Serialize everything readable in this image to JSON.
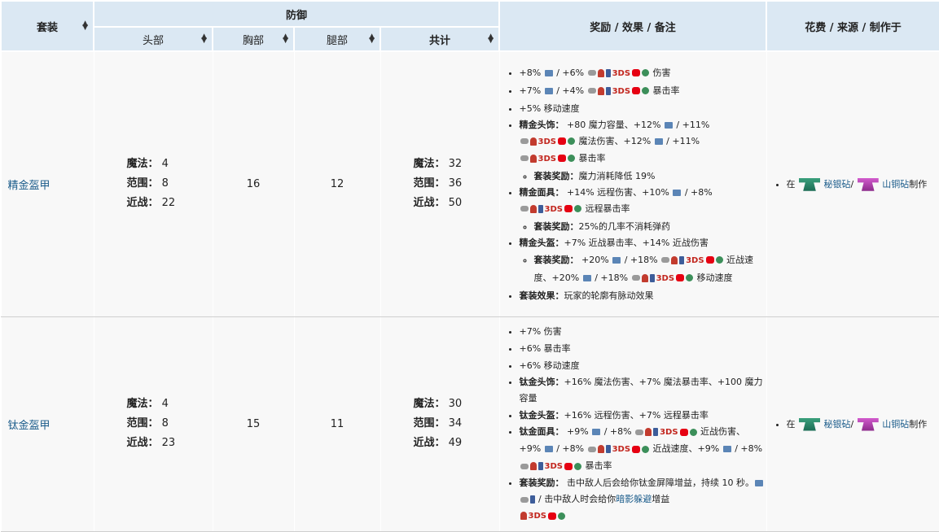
{
  "header": {
    "set": "套装",
    "defense": "防御",
    "head": "头部",
    "chest": "胸部",
    "legs": "腿部",
    "total": "共计",
    "bonus": "奖励 / 效果 / 备注",
    "cost": "花费 / 来源 / 制作于"
  },
  "row1": {
    "name": "精金盔甲",
    "magic_label": "魔法：",
    "range_label": "范围：",
    "melee_label": "近战：",
    "head_magic": "4",
    "head_range": "8",
    "head_melee": "22",
    "chest": "16",
    "legs": "12",
    "total_magic": "32",
    "total_range": "36",
    "total_melee": "50",
    "b1": "+8%",
    "b1b": "/ +6%",
    "b1c": "伤害",
    "b2": "+7%",
    "b2b": "/ +4%",
    "b2c": "暴击率",
    "b3": "+5% 移动速度",
    "b4_label": "精金头饰：",
    "b4a": "+80 魔力容量、+12%",
    "b4b": "/ +11%",
    "b4c": "魔法伤害、+12%",
    "b4d": "/ +11%",
    "b4e": "暴击率",
    "b4_sub_label": "套装奖励：",
    "b4_sub": "魔力消耗降低 19%",
    "b5_label": "精金面具：",
    "b5a": "+14% 远程伤害、+10%",
    "b5b": "/ +8%",
    "b5c": "远程暴击率",
    "b5_sub_label": "套装奖励：",
    "b5_sub": "25%的几率不消耗弹药",
    "b6_label": "精金头盔：",
    "b6a": "+7% 近战暴击率、+14% 近战伤害",
    "b6_sub_label": "套装奖励：",
    "b6_sub_a": "+20%",
    "b6_sub_b": "/ +18%",
    "b6_sub_c": "近战速度、+20%",
    "b6_sub_d": "/ +18%",
    "b6_sub_e": "移动速度",
    "b7_label": "套装效果：",
    "b7": "玩家的轮廓有脉动效果"
  },
  "row2": {
    "name": "钛金盔甲",
    "magic_label": "魔法：",
    "range_label": "范围：",
    "melee_label": "近战：",
    "head_magic": "4",
    "head_range": "8",
    "head_melee": "23",
    "chest": "15",
    "legs": "11",
    "total_magic": "30",
    "total_range": "34",
    "total_melee": "49",
    "b1": "+7% 伤害",
    "b2": "+6% 暴击率",
    "b3": "+6% 移动速度",
    "b4_label": "钛金头饰：",
    "b4": "+16% 魔法伤害、+7% 魔法暴击率、+100 魔力容量",
    "b5_label": "钛金头盔：",
    "b5": "+16% 远程伤害、+7% 远程暴击率",
    "b6_label": "钛金面具：",
    "b6a": "+9%",
    "b6b": "/ +8%",
    "b6c": "近战伤害、+9%",
    "b6d": "/ +8%",
    "b6e": "近战速度、+9%",
    "b6f": "/ +8%",
    "b6g": "暴击率",
    "b7_label": "套装奖励：",
    "b7a": "击中敌人后会给你钛金屏障增益，持续 10 秒。",
    "b7b": "/ 击中敌人时会给你",
    "b7_link": "暗影躲避",
    "b7c": "增益"
  },
  "craft": {
    "prefix": "在",
    "anvil1": "秘银砧",
    "sep": "/",
    "anvil2": "山铜砧",
    "suffix": "制作"
  }
}
